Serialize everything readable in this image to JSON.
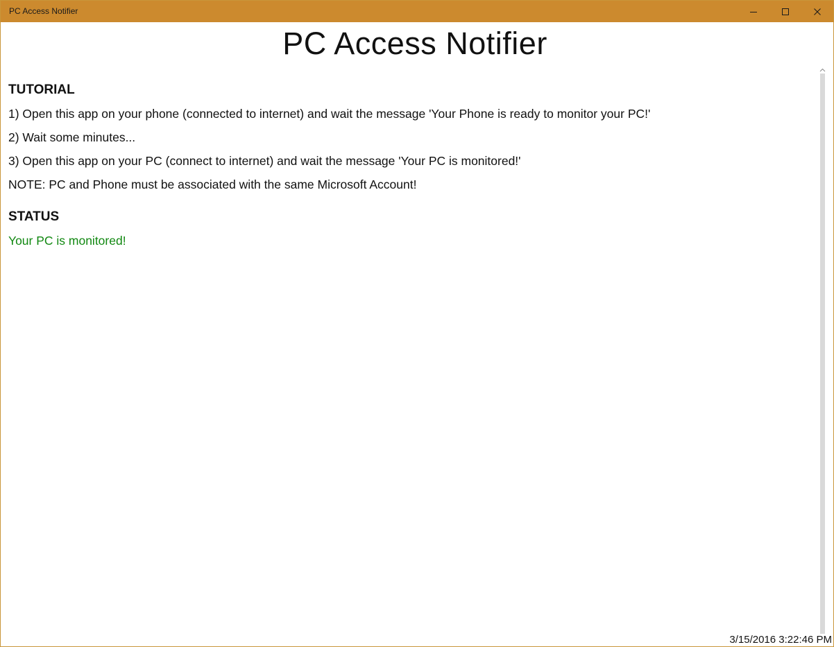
{
  "window": {
    "title": "PC Access Notifier",
    "accent_color": "#cc8a2e",
    "icons": {
      "minimize": "minimize-icon",
      "maximize": "maximize-icon",
      "close": "close-icon"
    }
  },
  "app": {
    "title": "PC Access Notifier"
  },
  "tutorial": {
    "heading": "TUTORIAL",
    "steps": [
      "1) Open this app on your phone (connected to internet) and wait the message 'Your Phone is ready to monitor your PC!'",
      "2) Wait some minutes...",
      "3) Open this app on your PC (connect to internet) and wait the message 'Your PC is monitored!'"
    ],
    "note": "NOTE: PC and Phone must be associated with the same Microsoft Account!"
  },
  "status": {
    "heading": "STATUS",
    "text": "Your PC is monitored!",
    "color": "#118811"
  },
  "footer": {
    "timestamp": "3/15/2016 3:22:46 PM"
  }
}
